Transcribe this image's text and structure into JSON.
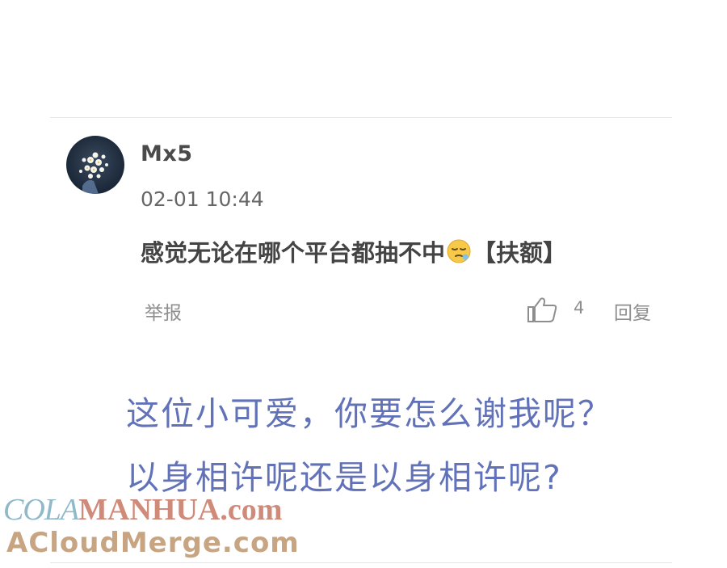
{
  "comment": {
    "username": "Mx5",
    "timestamp": "02-01 10:44",
    "text_before_emoji": "感觉无论在哪个平台都抽不中",
    "text_after_emoji": "【扶额】",
    "emoji_icon": "sleepy-face-icon",
    "avatar_icon": "flower-avatar-icon"
  },
  "actions": {
    "report_label": "举报",
    "like_icon": "thumbs-up-icon",
    "like_count": "4",
    "reply_label": "回复"
  },
  "caption": {
    "line1": "这位小可爱，你要怎么谢我呢？",
    "line2": "以身相许呢还是以身相许呢?"
  },
  "watermark": {
    "line1_part1": "COLA",
    "line1_part2": "MANHUA.com",
    "line2": "ACloudMerge.com"
  },
  "colors": {
    "caption": "#6272b8",
    "username": "#4a4a4a",
    "action": "#8e8e8e"
  }
}
